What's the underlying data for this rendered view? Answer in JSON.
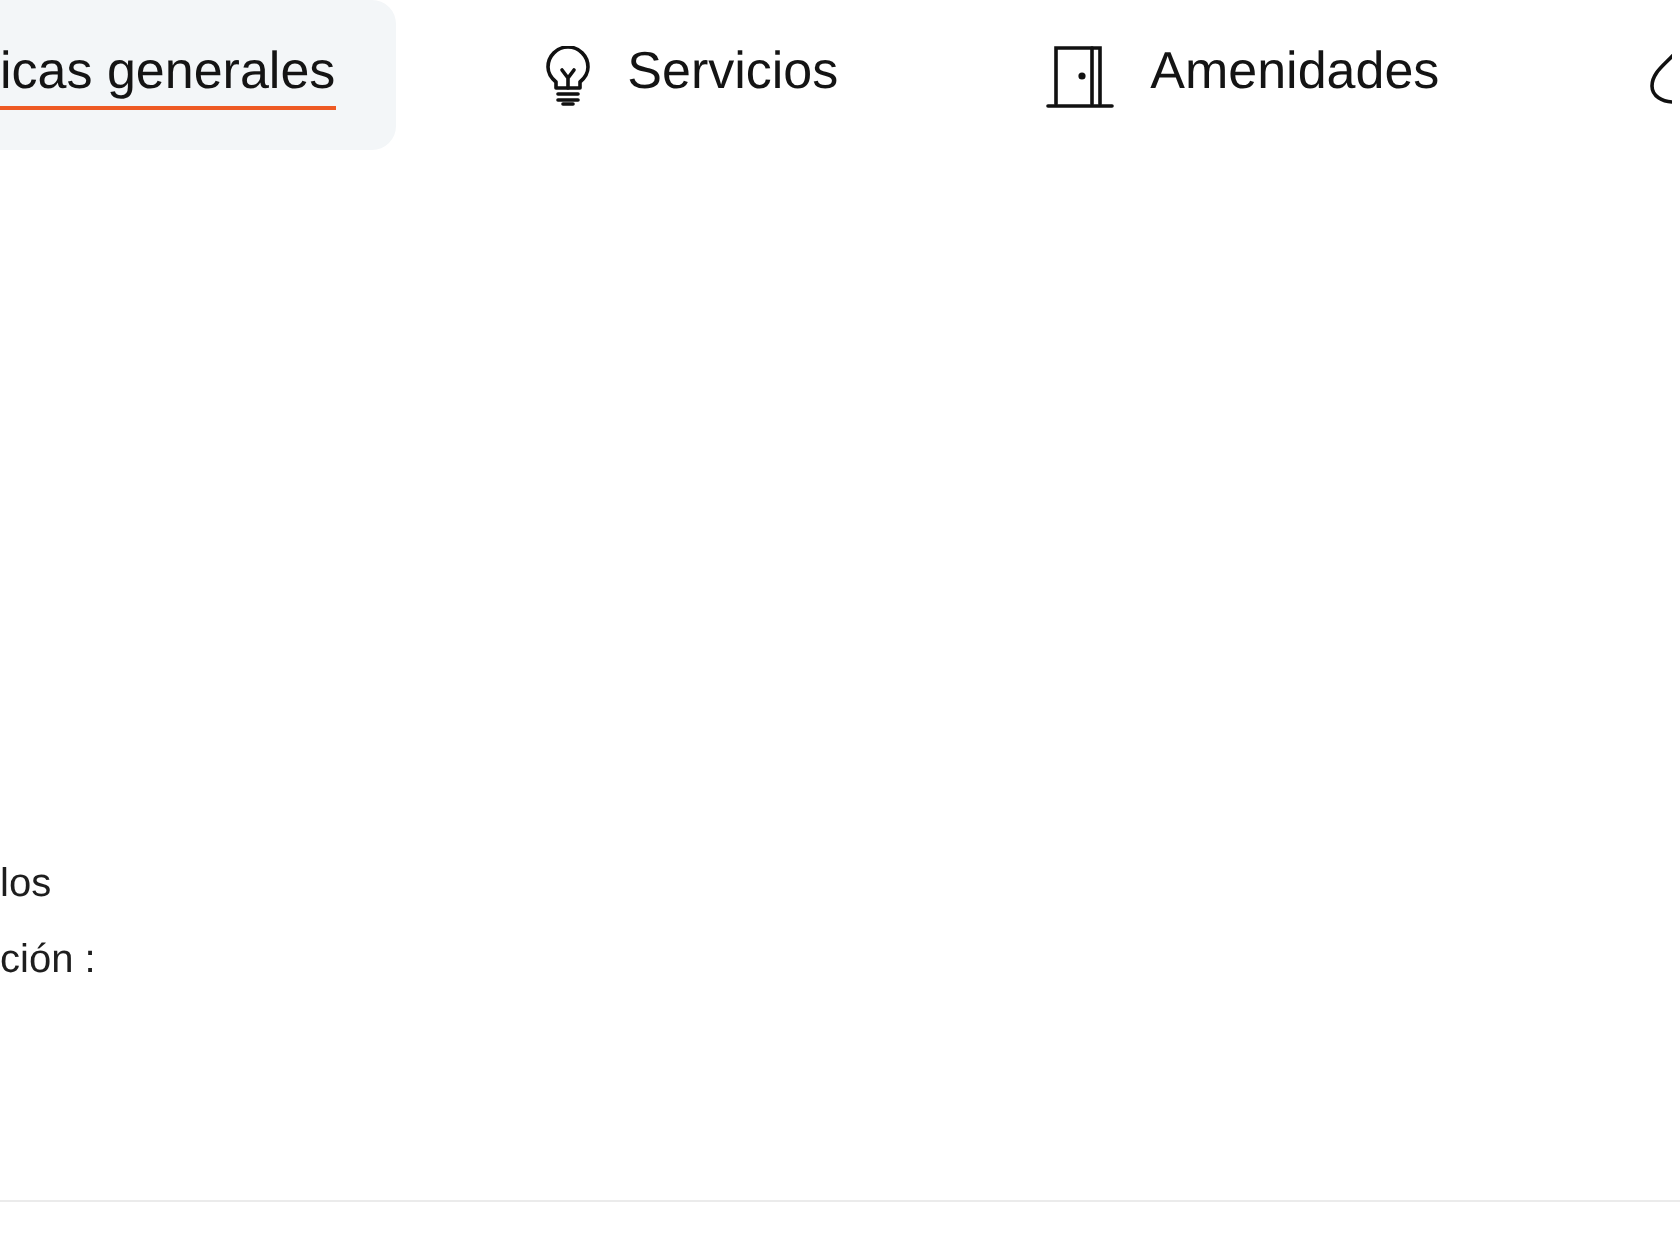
{
  "tabs": [
    {
      "label": "icas generales",
      "selected": true
    },
    {
      "label": "Servicios",
      "selected": false
    },
    {
      "label": "Amenidades",
      "selected": false
    },
    {
      "selected": false
    }
  ],
  "content": {
    "lines": [
      "los",
      "ción :"
    ]
  }
}
